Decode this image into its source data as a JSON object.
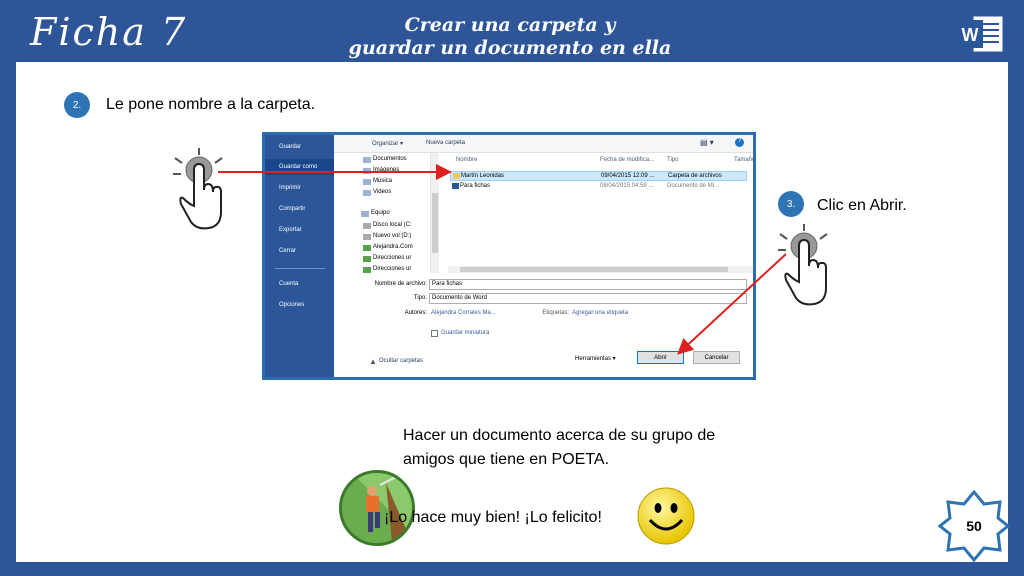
{
  "header": {
    "title": "Ficha 7",
    "subtitle_line1": "Crear una carpeta y",
    "subtitle_line2": "guardar un documento en ella",
    "logo_letter": "W"
  },
  "steps": [
    {
      "number": "2.",
      "text": "Le pone nombre a la carpeta."
    },
    {
      "number": "3.",
      "text": "Clic en Abrir."
    }
  ],
  "dialog": {
    "sidebar": [
      "Guardar",
      "Guardar como",
      "Imprimir",
      "Compartir",
      "Exportar",
      "Cerrar",
      "Cuenta",
      "Opciones"
    ],
    "toolbar": {
      "organize": "Organizar ▾",
      "new_folder": "Nueva carpeta"
    },
    "nav": [
      "Documentos",
      "Imágenes",
      "Música",
      "Videos",
      "Equipo",
      "Disco local (C:",
      "Nuevo vol (D:)",
      "Alejandra.Com",
      "Direcciones ur",
      "Direcciones ur"
    ],
    "columns": {
      "name": "Nombre",
      "date": "Fecha de modifica...",
      "type": "Tipo",
      "size": "Tamaño"
    },
    "rows": [
      {
        "name": "Martín Leonidas",
        "date": "09/04/2015 12:09 ...",
        "type": "Carpeta de archivos"
      },
      {
        "name": "Para fichas",
        "date": "08/04/2015 04:59 ...",
        "type": "Documento de Mi..."
      }
    ],
    "filename_label": "Nombre de archivo:",
    "filename_value": "Para fichas",
    "type_label": "Tipo:",
    "type_value": "Documento de Word",
    "authors_label": "Autores:",
    "authors_value": "Alejandra Corrales Ma...",
    "tags_label": "Etiquetas:",
    "tags_value": "Agregar una etiqueta",
    "thumbnail_label": "Guardar miniatura",
    "hide_folders": "Ocultar carpetas",
    "tools": "Herramientas ▾",
    "open_button": "Abrir",
    "cancel_button": "Cancelar"
  },
  "activity": {
    "line1": "Hacer un documento acerca de su grupo de",
    "line2": "amigos que tiene en POETA.",
    "praise": "¡Lo hace muy bien! ¡Lo felicito!"
  },
  "page_number": "50",
  "colors": {
    "background": "#2e5597",
    "dialog_border": "#2b6cb2",
    "arrow": "#e02020",
    "badge": "#2e74b5"
  }
}
